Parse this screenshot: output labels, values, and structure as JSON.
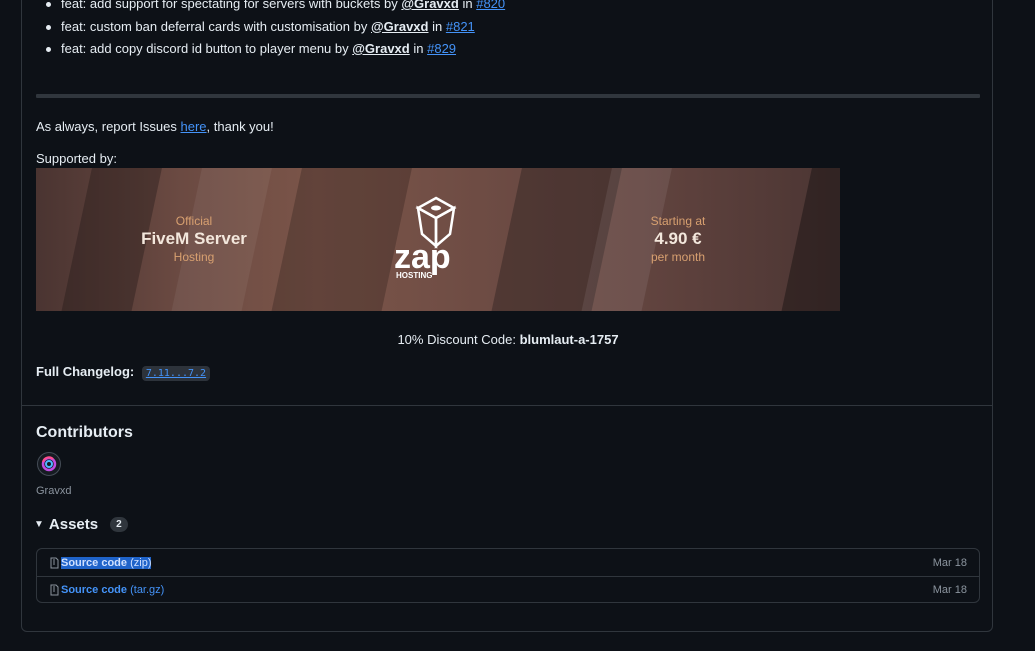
{
  "release_notes": {
    "items": [
      {
        "text": "feat: add support for spectating for servers with buckets by",
        "author": "@Gravxd",
        "in": "in",
        "pr": "#820"
      },
      {
        "text": "feat: custom ban deferral cards with customisation by",
        "author": "@Gravxd",
        "in": "in",
        "pr": "#821"
      },
      {
        "text": "feat: add copy discord id button to player menu by",
        "author": "@Gravxd",
        "in": "in",
        "pr": "#829"
      }
    ],
    "report_prefix": "As always, report Issues",
    "report_link": "here",
    "report_suffix": ", thank you!",
    "supported_by": "Supported by:",
    "discount_prefix": "10% Discount Code:",
    "discount_code": "blumlaut-a-1757",
    "full_changelog_label": "Full Changelog:",
    "full_changelog_range": "7.11...7.2"
  },
  "banner": {
    "left_small_top": "Official",
    "left_big": "FiveM Server",
    "left_small_bottom": "Hosting",
    "logo_text": "zap",
    "logo_subtext": "HOSTING",
    "right_small_top": "Starting at",
    "right_big": "4.90 €",
    "right_small_bottom": "per month",
    "colors": {
      "accent": "#d8a070",
      "bg": "#6b4a42"
    }
  },
  "contributors": {
    "heading": "Contributors",
    "list": [
      {
        "name": "Gravxd",
        "avatar_icon": "swirl-avatar"
      }
    ]
  },
  "assets": {
    "heading": "Assets",
    "count": "2",
    "items": [
      {
        "name": "Source code",
        "ext": "(zip)",
        "date": "Mar 18",
        "icon": "file-zip-icon"
      },
      {
        "name": "Source code",
        "ext": "(tar.gz)",
        "date": "Mar 18",
        "icon": "file-zip-icon"
      }
    ]
  }
}
